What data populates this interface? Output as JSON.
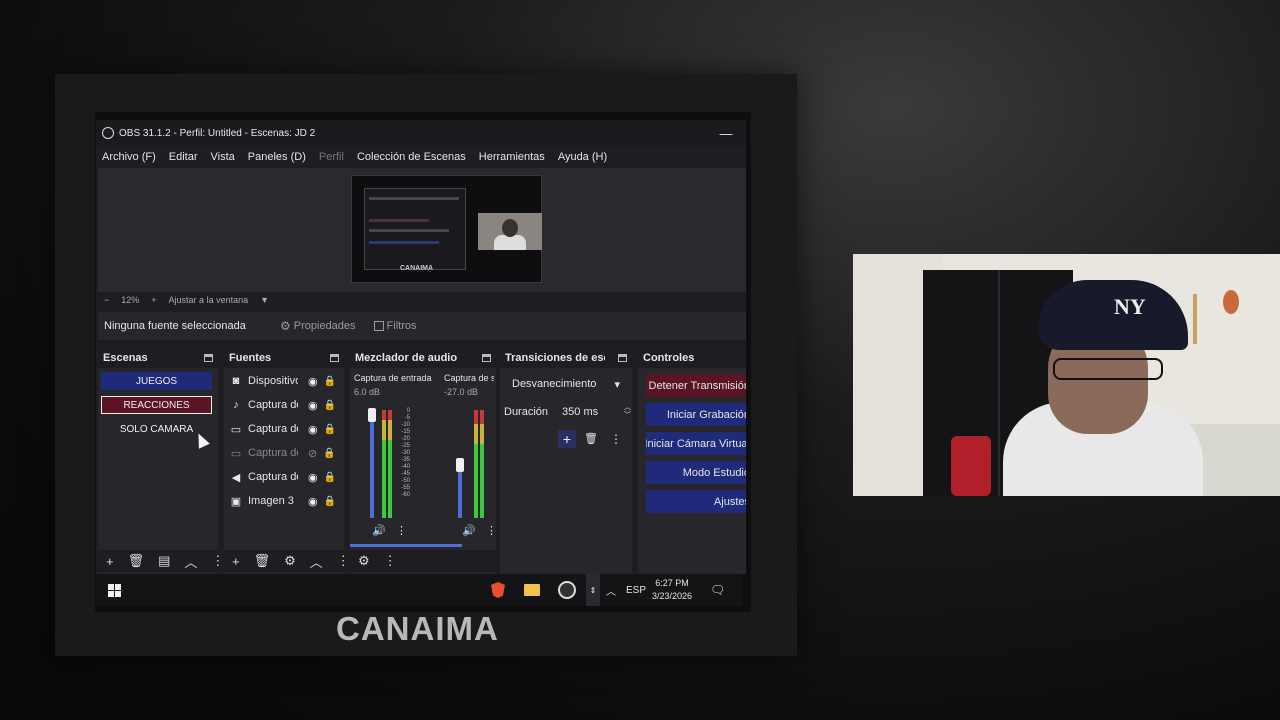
{
  "window": {
    "title": "OBS 31.1.2 - Perfil: Untitled - Escenas: JD 2",
    "minimize": "—"
  },
  "menu": [
    "Archivo (F)",
    "Editar",
    "Vista",
    "Paneles (D)",
    "Perfil",
    "Colección de Escenas",
    "Herramientas",
    "Ayuda (H)"
  ],
  "preview": {
    "brand": "CANAIMA"
  },
  "zoom": {
    "minus": "−",
    "level": "12%",
    "plus": "+",
    "fit": "Ajustar a la ventana",
    "caret": "▼"
  },
  "source_toolbar": {
    "no_selection": "Ninguna fuente seleccionada",
    "properties": "Propiedades",
    "filters": "Filtros"
  },
  "docks": {
    "scenes": {
      "title": "Escenas",
      "items": [
        "JUEGOS",
        "REACCIONES",
        "SOLO CAMARA"
      ]
    },
    "sources": {
      "title": "Fuentes",
      "items": [
        {
          "icon": "camera-icon",
          "label": "Dispositivo"
        },
        {
          "icon": "mic-icon",
          "label": "Captura de"
        },
        {
          "icon": "display-icon",
          "label": "Captura de"
        },
        {
          "icon": "window-icon",
          "label": "Captura de"
        },
        {
          "icon": "speaker-icon",
          "label": "Captura de"
        },
        {
          "icon": "image-icon",
          "label": "Imagen 3"
        }
      ]
    },
    "mixer": {
      "title": "Mezclador de audio",
      "channels": [
        {
          "name": "Captura de entrada",
          "db": "6.0 dB",
          "level": 0.78
        },
        {
          "name": "Captura de salida",
          "db": "-27.0 dB",
          "level": 0.7
        }
      ],
      "ticks": [
        "0",
        "-5",
        "-10",
        "-15",
        "-20",
        "-25",
        "-30",
        "-35",
        "-40",
        "-45",
        "-50",
        "-55",
        "-60"
      ]
    },
    "transitions": {
      "title": "Transiciones de escena",
      "selected": "Desvanecimiento",
      "duration_label": "Duración",
      "duration_value": "350 ms"
    },
    "controls": {
      "title": "Controles",
      "buttons": [
        "Detener Transmisión",
        "Iniciar Grabación",
        "Iniciar Cámara Virtual",
        "Modo Estudio",
        "Ajustes"
      ]
    }
  },
  "taskbar": {
    "language": "ESP",
    "time": "6:27 PM",
    "date": "3/23/2026"
  },
  "watermark": "CANAIMA",
  "webcam": {
    "cap_logo": "NY"
  }
}
